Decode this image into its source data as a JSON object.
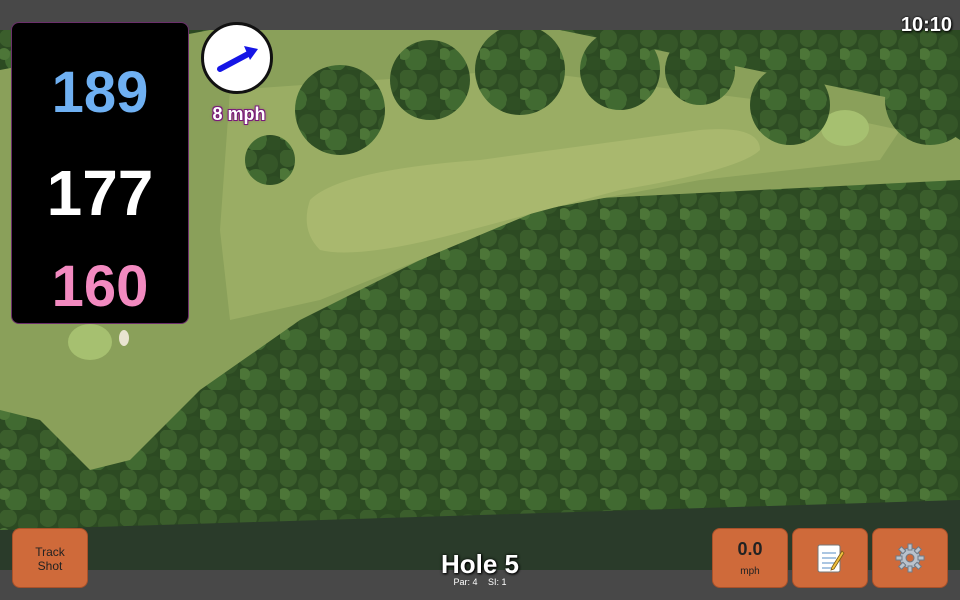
{
  "status": {
    "time": "10:10"
  },
  "distances": {
    "back": "189",
    "middle": "177",
    "front": "160"
  },
  "wind": {
    "speed_label": "8 mph",
    "speed_value": "0.0",
    "speed_unit": "mph",
    "direction_icon": "arrow-right-icon"
  },
  "buttons": {
    "track_shot_line1": "Track",
    "track_shot_line2": "Shot",
    "notes_icon": "notepad-icon",
    "settings_icon": "gear-icon"
  },
  "hole": {
    "title": "Hole 5",
    "par": "Par: 4",
    "si": "SI: 1"
  },
  "colors": {
    "back": "#6fb0f2",
    "middle": "#ffffff",
    "front": "#f28ac0",
    "button": "#cf6a3a",
    "bar": "#484848"
  }
}
